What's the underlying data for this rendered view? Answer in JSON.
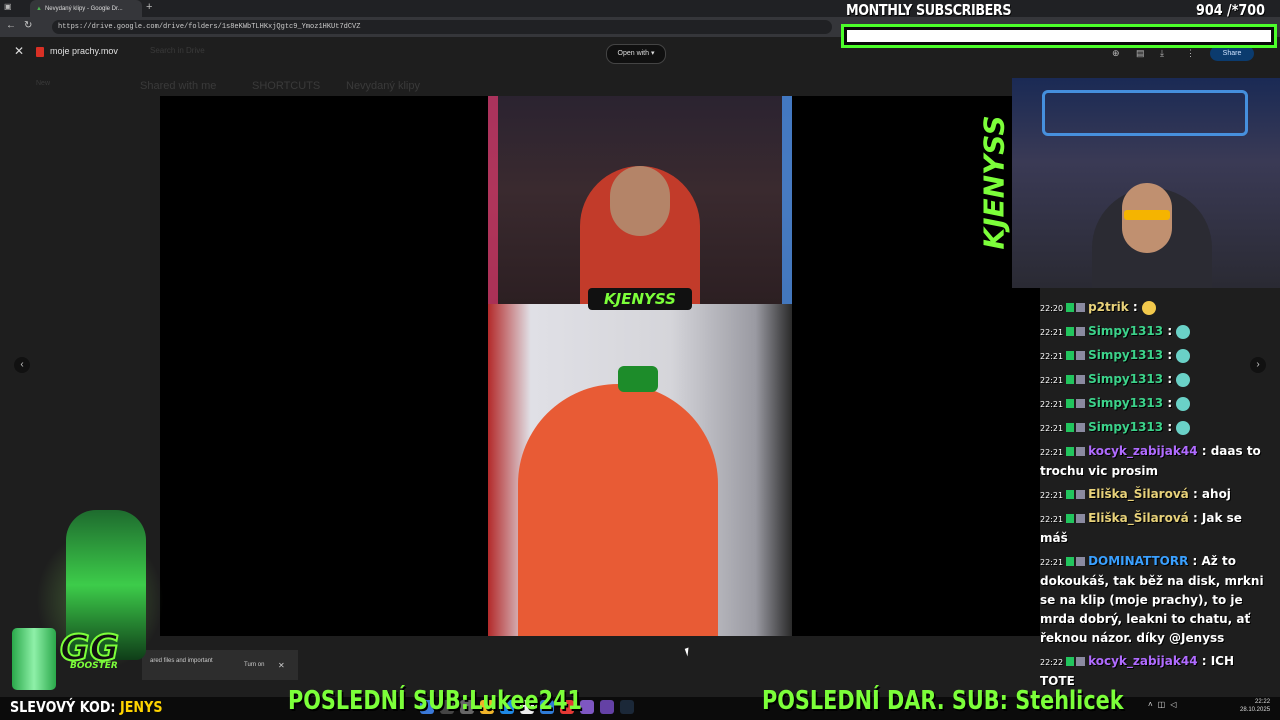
{
  "browser": {
    "tab_title": "Nevydaný klipy - Google Dr...",
    "url": "https://drive.google.com/drive/folders/1s8eKWbTLHKxjQgtc9_Ymoz1HKUt7dCVZ",
    "new_tab_label": "+"
  },
  "drive": {
    "file_name": "moje prachy.mov",
    "open_with_label": "Open with",
    "share_label": "Share",
    "search_ghost": "Search in Drive",
    "breadcrumb_ghost": [
      "Shared with me",
      "SHORTCUTS",
      "Nevydaný klipy"
    ],
    "new_ghost": "New",
    "toast_text": "ared files and important",
    "toast_action": "Turn on"
  },
  "video": {
    "overlay_logo": "KJENYSS"
  },
  "stream": {
    "subs_title": "MONTHLY SUBSCRIBERS",
    "subs_count": "904 /*700",
    "subs_progress": 1.0,
    "vertical_logo": "KJENYSS",
    "promo_label": "SLEVOVÝ KOD:",
    "promo_code": "JENYS",
    "last_sub": "POSLEDNÍ SUB:Lukee241",
    "last_gift_sub": "POSLEDNÍ DAR. SUB: Stehlicek",
    "gg_logo": "GG",
    "gg_sub": "BOOSTER",
    "accent": "#7cff3a"
  },
  "chat": [
    {
      "time": "22:20",
      "user": "p2trik",
      "color": "#e8d27a",
      "text": "",
      "emote": "yellow"
    },
    {
      "time": "22:21",
      "user": "Simpy1313",
      "color": "#3cd28a",
      "text": "",
      "emote": "teal"
    },
    {
      "time": "22:21",
      "user": "Simpy1313",
      "color": "#3cd28a",
      "text": "",
      "emote": "teal"
    },
    {
      "time": "22:21",
      "user": "Simpy1313",
      "color": "#3cd28a",
      "text": "",
      "emote": "teal"
    },
    {
      "time": "22:21",
      "user": "Simpy1313",
      "color": "#3cd28a",
      "text": "",
      "emote": "teal"
    },
    {
      "time": "22:21",
      "user": "Simpy1313",
      "color": "#3cd28a",
      "text": "",
      "emote": "teal"
    },
    {
      "time": "22:21",
      "user": "kocyk_zabijak44",
      "color": "#b06bff",
      "text": "daas to trochu vic prosim",
      "emote": ""
    },
    {
      "time": "22:21",
      "user": "Eliška_Šilarová",
      "color": "#e8d27a",
      "text": "ahoj",
      "emote": ""
    },
    {
      "time": "22:21",
      "user": "Eliška_Šilarová",
      "color": "#e8d27a",
      "text": "Jak se máš",
      "emote": ""
    },
    {
      "time": "22:21",
      "user": "DOMINATTORR",
      "color": "#3aa0ff",
      "text": "Až to dokoukáš, tak běž na disk, mrkni se na klip (moje prachy), to je mrda dobrý, leakni to chatu, ať řeknou názor. díky @Jenyss",
      "emote": ""
    },
    {
      "time": "22:22",
      "user": "kocyk_zabijak44",
      "color": "#b06bff",
      "text": "ICH TOTE",
      "emote": ""
    }
  ],
  "taskbar": {
    "clock_time": "22:22",
    "clock_date": "28.10.2025"
  }
}
